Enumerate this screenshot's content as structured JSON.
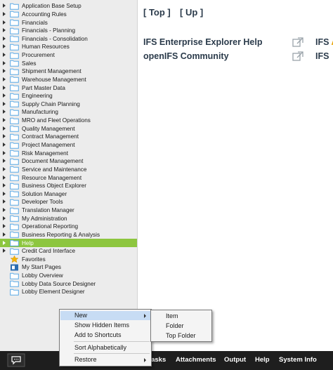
{
  "navigator": {
    "items": [
      {
        "label": "Application Base Setup",
        "expandable": true
      },
      {
        "label": "Accounting Rules",
        "expandable": true
      },
      {
        "label": "Financials",
        "expandable": true
      },
      {
        "label": "Financials - Planning",
        "expandable": true
      },
      {
        "label": "Financials - Consolidation",
        "expandable": true
      },
      {
        "label": "Human Resources",
        "expandable": true
      },
      {
        "label": "Procurement",
        "expandable": true
      },
      {
        "label": "Sales",
        "expandable": true
      },
      {
        "label": "Shipment Management",
        "expandable": true
      },
      {
        "label": "Warehouse Management",
        "expandable": true
      },
      {
        "label": "Part Master Data",
        "expandable": true
      },
      {
        "label": "Engineering",
        "expandable": true
      },
      {
        "label": "Supply Chain Planning",
        "expandable": true
      },
      {
        "label": "Manufacturing",
        "expandable": true
      },
      {
        "label": "MRO and Fleet Operations",
        "expandable": true
      },
      {
        "label": "Quality Management",
        "expandable": true
      },
      {
        "label": "Contract Management",
        "expandable": true
      },
      {
        "label": "Project Management",
        "expandable": true
      },
      {
        "label": "Risk Management",
        "expandable": true
      },
      {
        "label": "Document Management",
        "expandable": true
      },
      {
        "label": "Service and Maintenance",
        "expandable": true
      },
      {
        "label": "Resource Management",
        "expandable": true
      },
      {
        "label": "Business Object Explorer",
        "expandable": true
      },
      {
        "label": "Solution Manager",
        "expandable": true
      },
      {
        "label": "Developer Tools",
        "expandable": true
      },
      {
        "label": "Translation Manager",
        "expandable": true
      },
      {
        "label": "My Administration",
        "expandable": true
      },
      {
        "label": "Operational Reporting",
        "expandable": true
      },
      {
        "label": "Business Reporting & Analysis",
        "expandable": true
      },
      {
        "label": "Help",
        "expandable": true,
        "selected": true
      },
      {
        "label": "Credit Card Interface",
        "expandable": true
      },
      {
        "label": "Favorites",
        "expandable": false,
        "icon": "star-icon"
      },
      {
        "label": "My Start Pages",
        "expandable": false,
        "icon": "start-page-icon"
      },
      {
        "label": "Lobby Overview",
        "expandable": false
      },
      {
        "label": "Lobby Data Source Designer",
        "expandable": false
      },
      {
        "label": "Lobby Element Designer",
        "expandable": false
      }
    ]
  },
  "main": {
    "nav": {
      "top": "[ Top ]",
      "up": "[ Up ]"
    },
    "links": [
      {
        "label": "IFS Enterprise Explorer Help",
        "cut_prefix": "IFS",
        "cut_accent": "A"
      },
      {
        "label": "openIFS Community",
        "cut_prefix": "IFS",
        "cut_accent": ""
      }
    ]
  },
  "context_menu": {
    "items": [
      {
        "label": "New",
        "has_submenu": true,
        "highlighted": true
      },
      {
        "label": "Show Hidden Items"
      },
      {
        "label": "Add to Shortcuts"
      },
      {
        "label": "Sort Alphabetically"
      },
      {
        "label": "Restore",
        "has_submenu": true
      }
    ]
  },
  "submenu": {
    "items": [
      {
        "label": "Item"
      },
      {
        "label": "Folder"
      },
      {
        "label": "Top Folder"
      }
    ]
  },
  "bottom_bar": {
    "items": [
      "Tasks",
      "Attachments",
      "Output",
      "Help",
      "System Info"
    ]
  },
  "colors": {
    "selected_row": "#8dc63f",
    "folder": "#5aa9e6",
    "bottom_bar": "#1e1e1e",
    "menu_highlight": "#c7dcf4"
  }
}
